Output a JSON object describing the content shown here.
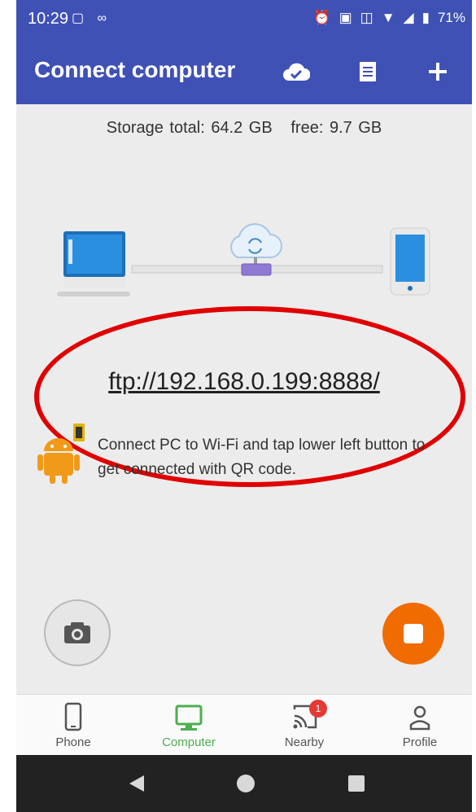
{
  "status_bar": {
    "time": "10:29",
    "battery": "71%",
    "icons": [
      "gallery-icon",
      "voicemail-icon",
      "alarm-icon",
      "nfc-icon",
      "vibrate-icon",
      "wifi-icon",
      "signal-icon",
      "battery-icon"
    ]
  },
  "app_bar": {
    "title": "Connect computer",
    "actions": [
      "cloud-check-icon",
      "list-icon",
      "add-icon"
    ]
  },
  "storage_text": "Storage total: 64.2 GB   free: 9.7 GB",
  "ftp_url": "ftp://192.168.0.199:8888/",
  "hint_text": "Connect PC to Wi-Fi and tap lower left button to get connected with QR code.",
  "bottom_nav": {
    "items": [
      {
        "label": "Phone",
        "active": false
      },
      {
        "label": "Computer",
        "active": true
      },
      {
        "label": "Nearby",
        "active": false,
        "badge": "1"
      },
      {
        "label": "Profile",
        "active": false
      }
    ]
  },
  "colors": {
    "primary": "#3f51b5",
    "accent_orange": "#f06b00",
    "active_green": "#4caf50",
    "annotation_red": "#e00000",
    "badge_red": "#e53935"
  }
}
